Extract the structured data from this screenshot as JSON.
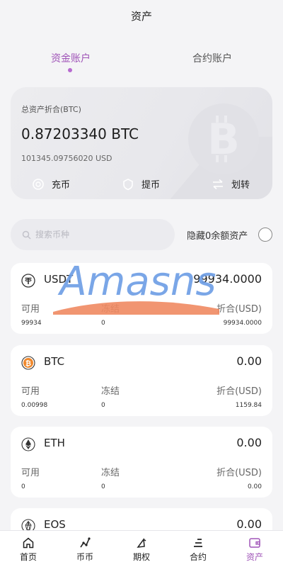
{
  "header": {
    "title": "资产"
  },
  "tabs": [
    {
      "label": "资金账户",
      "active": true
    },
    {
      "label": "合约账户",
      "active": false
    }
  ],
  "summary": {
    "label": "总资产折合(BTC)",
    "btc_value": "0.87203340 BTC",
    "usd_value": "101345.09756020 USD",
    "actions": [
      {
        "label": "充币",
        "icon": "deposit-icon"
      },
      {
        "label": "提币",
        "icon": "withdraw-icon"
      },
      {
        "label": "划转",
        "icon": "transfer-icon"
      }
    ]
  },
  "search": {
    "placeholder": "搜索币种",
    "value": ""
  },
  "hide_zero": {
    "label": "隐藏0余额资产",
    "checked": false
  },
  "labels": {
    "available": "可用",
    "frozen": "冻结",
    "equiv": "折合(USD)"
  },
  "assets": [
    {
      "name": "USDT",
      "total": "99934.0000",
      "available": "99934",
      "frozen": "0",
      "equiv": "99934.0000",
      "icon": "usdt-icon"
    },
    {
      "name": "BTC",
      "total": "0.00",
      "available": "0.00998",
      "frozen": "0",
      "equiv": "1159.84",
      "icon": "btc-icon"
    },
    {
      "name": "ETH",
      "total": "0.00",
      "available": "0",
      "frozen": "0",
      "equiv": "0.00",
      "icon": "eth-icon"
    },
    {
      "name": "EOS",
      "total": "0.00",
      "icon": "eos-icon"
    }
  ],
  "watermark": {
    "text": "Amasns"
  },
  "nav": [
    {
      "label": "首页",
      "icon": "home-icon",
      "active": false
    },
    {
      "label": "币币",
      "icon": "spot-icon",
      "active": false
    },
    {
      "label": "期权",
      "icon": "options-icon",
      "active": false
    },
    {
      "label": "合约",
      "icon": "contract-icon",
      "active": false
    },
    {
      "label": "资产",
      "icon": "wallet-icon",
      "active": true
    }
  ],
  "colors": {
    "accent": "#a055b8",
    "brand_blue": "#6f9fe6",
    "brand_orange": "#f08a62"
  }
}
